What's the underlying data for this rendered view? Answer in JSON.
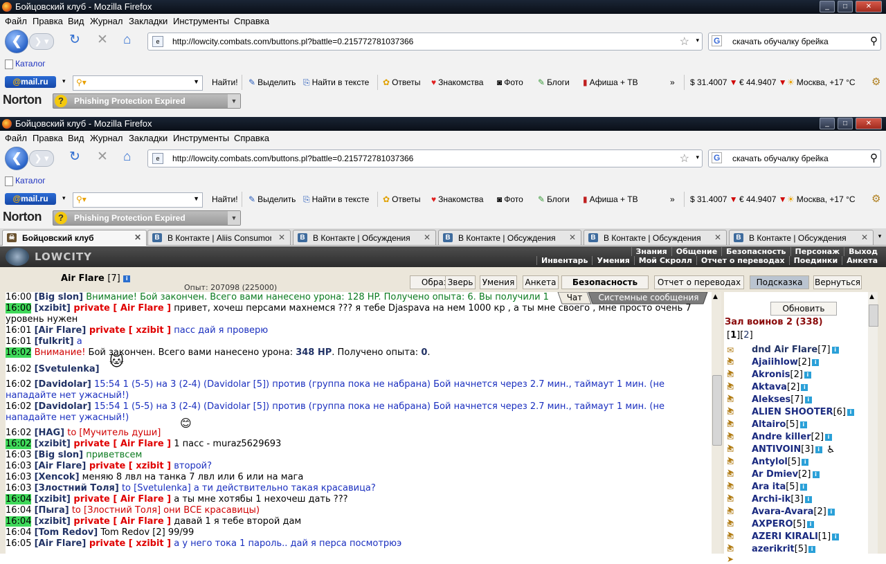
{
  "window": {
    "title": "Бойцовский клуб - Mozilla Firefox",
    "controls": [
      "_",
      "□",
      "✕"
    ]
  },
  "menu": [
    "Файл",
    "Правка",
    "Вид",
    "Журнал",
    "Закладки",
    "Инструменты",
    "Справка"
  ],
  "address": {
    "url": "http://lowcity.combats.com/buttons.pl?battle=0.215772781037366",
    "search_engine": "G",
    "search_value": "скачать обучалку брейка"
  },
  "bookmarks": {
    "folder_label": "Каталог"
  },
  "mailru": {
    "logo_at": "@",
    "logo_text": "mail.ru",
    "find": "Найти!",
    "items": [
      "Выделить",
      "Найти в тексте",
      "Ответы",
      "Знакомства",
      "Фото",
      "Блоги",
      "Афиша + ТВ"
    ],
    "more": "»",
    "usd": "$ 31.4007",
    "eur": "€ 44.9407",
    "weather": "Москва, +17 °C"
  },
  "norton": {
    "logo": "Norton",
    "phishing": "Phishing Protection Expired"
  },
  "tabs": [
    {
      "label": "Бойцовский клуб",
      "active": true
    },
    {
      "label": "В Контакте | Aliis Consumor",
      "active": false
    },
    {
      "label": "В Контакте | Обсуждения",
      "active": false
    },
    {
      "label": "В Контакте | Обсуждения",
      "active": false
    },
    {
      "label": "В Контакте | Обсуждения",
      "active": false
    },
    {
      "label": "В Контакте | Обсуждения",
      "active": false
    }
  ],
  "game": {
    "logo": "LOWCITY",
    "menu_top": [
      "Знания",
      "Общение",
      "Безопасность",
      "Персонаж",
      "Выход"
    ],
    "menu_bottom": [
      "Инвентарь",
      "Умения",
      "Мой Скролл",
      "Отчет о переводах",
      "Поединки",
      "Анкета"
    ],
    "char_name": "Air Flare",
    "char_level": "[7]",
    "opyt": "Опыт: 207098 (225000)",
    "buttons": [
      "Образ",
      "Зверь",
      "Умения",
      "Анкета",
      "Безопасность",
      "Отчет о переводах",
      "Подсказка",
      "Вернуться"
    ],
    "chat_tabs": [
      "Чат",
      "Системные сообщения"
    ],
    "refresh": "Обновить",
    "hall": "Зал воинов 2 (338)",
    "pages": [
      "[",
      "1",
      "][",
      "2",
      "]"
    ],
    "players": [
      {
        "name": "dnd Air Flare",
        "lvl": "[7]"
      },
      {
        "name": "Ajaiihlow",
        "lvl": "[2]"
      },
      {
        "name": "Akronis",
        "lvl": "[2]"
      },
      {
        "name": "Aktava",
        "lvl": "[2]"
      },
      {
        "name": "Alekses",
        "lvl": "[7]"
      },
      {
        "name": "ALIEN SHOOTER",
        "lvl": "[6]"
      },
      {
        "name": "Altairo",
        "lvl": "[5]"
      },
      {
        "name": "Andre killer",
        "lvl": "[2]"
      },
      {
        "name": "ANTIVOIN",
        "lvl": "[3]"
      },
      {
        "name": "Antylol",
        "lvl": "[5]"
      },
      {
        "name": "Ar Dmiev",
        "lvl": "[2]"
      },
      {
        "name": "Ara ita",
        "lvl": "[5]"
      },
      {
        "name": "Archi-ik",
        "lvl": "[3]"
      },
      {
        "name": "Avara-Avara",
        "lvl": "[2]"
      },
      {
        "name": "AXPERO",
        "lvl": "[5]"
      },
      {
        "name": "AZERI KIRALI",
        "lvl": "[1]"
      },
      {
        "name": "azerikrit",
        "lvl": "[5]"
      }
    ],
    "chat": [
      {
        "time": "16:00",
        "parts": [
          [
            "nk",
            "[Big slon]"
          ],
          [
            "gr",
            " Внимание! Бой закончен. Всего вами нанесено урона: 128 HP. Получено опыта: 6. Вы получили 1"
          ]
        ]
      },
      {
        "time": "16:00",
        "hl": true,
        "parts": [
          [
            "nk",
            "[xzibit]"
          ],
          [
            "pv",
            " private [ Air Flare ]"
          ],
          [
            "t",
            " привет, хочеш персами махнемся ??? я тебе Djaspava на нем 1000 кр , а ты мне своего , мне просто очень 7"
          ]
        ]
      },
      {
        "time": "",
        "parts": [
          [
            "t",
            "уровень нужен"
          ]
        ]
      },
      {
        "time": "16:01",
        "parts": [
          [
            "nk",
            "[Air Flare]"
          ],
          [
            "pv",
            " private [ xzibit ]"
          ],
          [
            "bl",
            " пасс дай я проверю"
          ]
        ]
      },
      {
        "time": "16:01",
        "parts": [
          [
            "nk",
            "[fulkrit]"
          ],
          [
            "bl",
            " а"
          ]
        ]
      },
      {
        "time": "16:02",
        "hl": true,
        "parts": [
          [
            "red",
            "Внимание!"
          ],
          [
            "t",
            " Бой закончен. Всего вами нанесено урона: "
          ],
          [
            "nk",
            "348 HP"
          ],
          [
            "t",
            ". Получено опыта: "
          ],
          [
            "nk",
            "0"
          ],
          [
            "t",
            "."
          ]
        ]
      },
      {
        "time": "16:02",
        "parts": [
          [
            "nk",
            "[Svetulenka]"
          ]
        ]
      },
      {
        "time": "16:02",
        "parts": [
          [
            "nk",
            "[Davidolar]"
          ],
          [
            "bl",
            " 15:54 1 (5-5) на 3 (2-4) (Davidolar [5]) против (группа пока не набрана) Бой начнется через 2.7 мин., таймаут 1 мин. (не"
          ]
        ]
      },
      {
        "time": "",
        "parts": [
          [
            "bl",
            "нападайте нет ужасный!)"
          ]
        ]
      },
      {
        "time": "16:02",
        "parts": [
          [
            "nk",
            "[Davidolar]"
          ],
          [
            "bl",
            " 15:54 1 (5-5) на 3 (2-4) (Davidolar [5]) против (группа пока не набрана) Бой начнется через 2.7 мин., таймаут 1 мин. (не"
          ]
        ]
      },
      {
        "time": "",
        "parts": [
          [
            "bl",
            "нападайте нет ужасный!)"
          ]
        ]
      },
      {
        "time": "16:02",
        "parts": [
          [
            "nk",
            "[HAG]"
          ],
          [
            "red",
            " to [Мучитель души]"
          ]
        ]
      },
      {
        "time": "16:02",
        "hl": true,
        "parts": [
          [
            "nk",
            "[xzibit]"
          ],
          [
            "pv",
            " private [ Air Flare ]"
          ],
          [
            "t",
            " 1 пасс - muraz5629693"
          ]
        ]
      },
      {
        "time": "16:03",
        "parts": [
          [
            "nk",
            "[Big slon]"
          ],
          [
            "gr",
            " приветвсем"
          ]
        ]
      },
      {
        "time": "16:03",
        "parts": [
          [
            "nk",
            "[Air Flare]"
          ],
          [
            "pv",
            " private [ xzibit ]"
          ],
          [
            "bl",
            " второй?"
          ]
        ]
      },
      {
        "time": "16:03",
        "parts": [
          [
            "nk",
            "[Xencok]"
          ],
          [
            "t",
            " меняю 8 лвл на танка 7 лвл или 6 или на мага"
          ]
        ]
      },
      {
        "time": "16:03",
        "parts": [
          [
            "nk",
            "[Злостний Толя]"
          ],
          [
            "bl",
            " to [Svetulenka] а ти действительно такая красавица?"
          ]
        ]
      },
      {
        "time": "16:04",
        "hl": true,
        "parts": [
          [
            "nk",
            "[xzibit]"
          ],
          [
            "pv",
            " private [ Air Flare ]"
          ],
          [
            "t",
            " а ты мне хотябы 1 нехочеш дать ???"
          ]
        ]
      },
      {
        "time": "16:04",
        "parts": [
          [
            "nk",
            "[Пыга]"
          ],
          [
            "red",
            " to [Злостний Толя] они ВСЕ красавицы)"
          ]
        ]
      },
      {
        "time": "16:04",
        "hl": true,
        "parts": [
          [
            "nk",
            "[xzibit]"
          ],
          [
            "pv",
            " private [ Air Flare ]"
          ],
          [
            "t",
            " давай 1 я тебе второй дам"
          ]
        ]
      },
      {
        "time": "16:04",
        "parts": [
          [
            "nk",
            "[Tom Redov]"
          ],
          [
            "t",
            " Tom Redov [2] 99/99"
          ]
        ]
      },
      {
        "time": "16:05",
        "parts": [
          [
            "nk",
            "[Air Flare]"
          ],
          [
            "pv",
            " private [ xzibit ]"
          ],
          [
            "bl",
            " а у него тока 1 пароль.. дай я перса посмотрюэ"
          ]
        ]
      }
    ]
  }
}
